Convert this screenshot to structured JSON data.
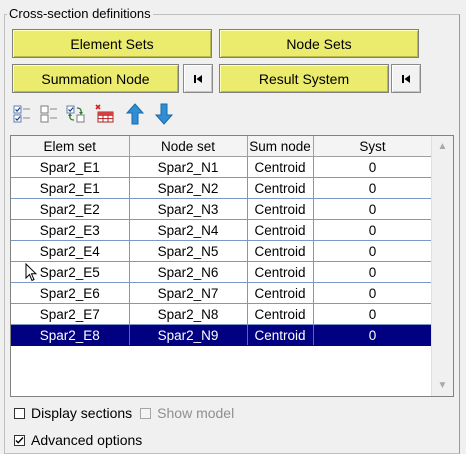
{
  "group": {
    "title": "Cross-section definitions"
  },
  "buttons": {
    "element_sets": "Element Sets",
    "node_sets": "Node Sets",
    "summation_node": "Summation Node",
    "result_system": "Result System"
  },
  "toolbar": {
    "icons": [
      "check-all-icon",
      "uncheck-all-icon",
      "swap-check-icon",
      "delete-table-icon",
      "move-up-icon",
      "move-down-icon"
    ]
  },
  "table": {
    "columns": [
      "Elem set",
      "Node set",
      "Sum node",
      "Syst"
    ],
    "rows": [
      [
        "Spar2_E1",
        "Spar2_N1",
        "Centroid",
        "0"
      ],
      [
        "Spar2_E1",
        "Spar2_N2",
        "Centroid",
        "0"
      ],
      [
        "Spar2_E2",
        "Spar2_N3",
        "Centroid",
        "0"
      ],
      [
        "Spar2_E3",
        "Spar2_N4",
        "Centroid",
        "0"
      ],
      [
        "Spar2_E4",
        "Spar2_N5",
        "Centroid",
        "0"
      ],
      [
        "Spar2_E5",
        "Spar2_N6",
        "Centroid",
        "0"
      ],
      [
        "Spar2_E6",
        "Spar2_N7",
        "Centroid",
        "0"
      ],
      [
        "Spar2_E7",
        "Spar2_N8",
        "Centroid",
        "0"
      ],
      [
        "Spar2_E8",
        "Spar2_N9",
        "Centroid",
        "0"
      ]
    ],
    "selected_row": 8
  },
  "options": {
    "display_sections": "Display sections",
    "show_model": "Show model",
    "advanced_options": "Advanced options"
  },
  "colors": {
    "button_yellow": "#ebeb6e",
    "selection": "#000080",
    "arrow_blue": "#2e8fd6"
  }
}
